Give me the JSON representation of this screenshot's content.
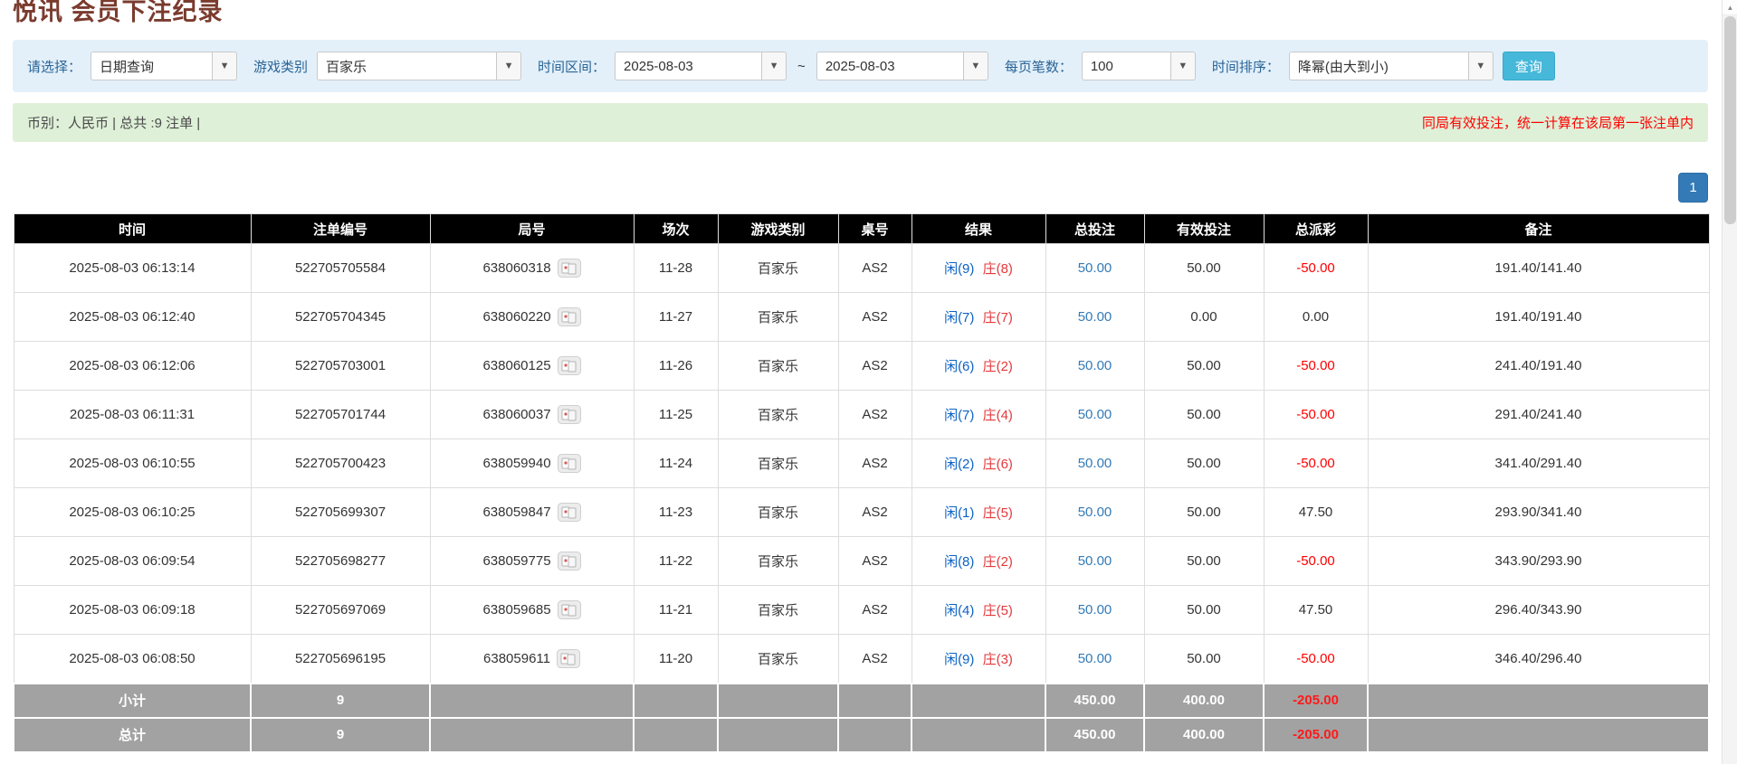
{
  "page": {
    "title": "悦讯 会员下注纪录"
  },
  "colors": {
    "accent_blue": "#337ab7",
    "alert_red": "#ff0000",
    "filter_bg": "#e3f0fa",
    "summary_bg": "#dff0d8",
    "header_bg": "#000000",
    "footer_bg": "#a2a2a2"
  },
  "filters": {
    "select_label": "请选择：",
    "select_value": "日期查询",
    "game_type_label": "游戏类别",
    "game_type_value": "百家乐",
    "time_range_label": "时间区间：",
    "time_from": "2025-08-03",
    "tilde": "~",
    "time_to": "2025-08-03",
    "per_page_label": "每页笔数：",
    "per_page_value": "100",
    "sort_label": "时间排序：",
    "sort_value": "降幂(由大到小)",
    "search_button": "查询"
  },
  "summary": {
    "left": "币别：人民币 | 总共 :9 注单 |",
    "right": "同局有效投注，统一计算在该局第一张注单内"
  },
  "pagination": {
    "current_page": "1"
  },
  "table": {
    "headers": [
      "时间",
      "注单编号",
      "局号",
      "场次",
      "游戏类别",
      "桌号",
      "结果",
      "总投注",
      "有效投注",
      "总派彩",
      "备注"
    ],
    "rows": [
      {
        "time": "2025-08-03 06:13:14",
        "bet_no": "522705705584",
        "round_no": "638060318",
        "session": "11-28",
        "game": "百家乐",
        "table_no": "AS2",
        "player": "闲(9)",
        "banker": "庄(8)",
        "total_bet": "50.00",
        "valid_bet": "50.00",
        "payout": "-50.00",
        "payout_neg": true,
        "note": "191.40/141.40"
      },
      {
        "time": "2025-08-03 06:12:40",
        "bet_no": "522705704345",
        "round_no": "638060220",
        "session": "11-27",
        "game": "百家乐",
        "table_no": "AS2",
        "player": "闲(7)",
        "banker": "庄(7)",
        "total_bet": "50.00",
        "valid_bet": "0.00",
        "payout": "0.00",
        "payout_neg": false,
        "note": "191.40/191.40"
      },
      {
        "time": "2025-08-03 06:12:06",
        "bet_no": "522705703001",
        "round_no": "638060125",
        "session": "11-26",
        "game": "百家乐",
        "table_no": "AS2",
        "player": "闲(6)",
        "banker": "庄(2)",
        "total_bet": "50.00",
        "valid_bet": "50.00",
        "payout": "-50.00",
        "payout_neg": true,
        "note": "241.40/191.40"
      },
      {
        "time": "2025-08-03 06:11:31",
        "bet_no": "522705701744",
        "round_no": "638060037",
        "session": "11-25",
        "game": "百家乐",
        "table_no": "AS2",
        "player": "闲(7)",
        "banker": "庄(4)",
        "total_bet": "50.00",
        "valid_bet": "50.00",
        "payout": "-50.00",
        "payout_neg": true,
        "note": "291.40/241.40"
      },
      {
        "time": "2025-08-03 06:10:55",
        "bet_no": "522705700423",
        "round_no": "638059940",
        "session": "11-24",
        "game": "百家乐",
        "table_no": "AS2",
        "player": "闲(2)",
        "banker": "庄(6)",
        "total_bet": "50.00",
        "valid_bet": "50.00",
        "payout": "-50.00",
        "payout_neg": true,
        "note": "341.40/291.40"
      },
      {
        "time": "2025-08-03 06:10:25",
        "bet_no": "522705699307",
        "round_no": "638059847",
        "session": "11-23",
        "game": "百家乐",
        "table_no": "AS2",
        "player": "闲(1)",
        "banker": "庄(5)",
        "total_bet": "50.00",
        "valid_bet": "50.00",
        "payout": "47.50",
        "payout_neg": false,
        "note": "293.90/341.40"
      },
      {
        "time": "2025-08-03 06:09:54",
        "bet_no": "522705698277",
        "round_no": "638059775",
        "session": "11-22",
        "game": "百家乐",
        "table_no": "AS2",
        "player": "闲(8)",
        "banker": "庄(2)",
        "total_bet": "50.00",
        "valid_bet": "50.00",
        "payout": "-50.00",
        "payout_neg": true,
        "note": "343.90/293.90"
      },
      {
        "time": "2025-08-03 06:09:18",
        "bet_no": "522705697069",
        "round_no": "638059685",
        "session": "11-21",
        "game": "百家乐",
        "table_no": "AS2",
        "player": "闲(4)",
        "banker": "庄(5)",
        "total_bet": "50.00",
        "valid_bet": "50.00",
        "payout": "47.50",
        "payout_neg": false,
        "note": "296.40/343.90"
      },
      {
        "time": "2025-08-03 06:08:50",
        "bet_no": "522705696195",
        "round_no": "638059611",
        "session": "11-20",
        "game": "百家乐",
        "table_no": "AS2",
        "player": "闲(9)",
        "banker": "庄(3)",
        "total_bet": "50.00",
        "valid_bet": "50.00",
        "payout": "-50.00",
        "payout_neg": true,
        "note": "346.40/296.40"
      }
    ],
    "subtotal": {
      "label": "小计",
      "count": "9",
      "total_bet": "450.00",
      "valid_bet": "400.00",
      "payout": "-205.00"
    },
    "total": {
      "label": "总计",
      "count": "9",
      "total_bet": "450.00",
      "valid_bet": "400.00",
      "payout": "-205.00"
    }
  }
}
